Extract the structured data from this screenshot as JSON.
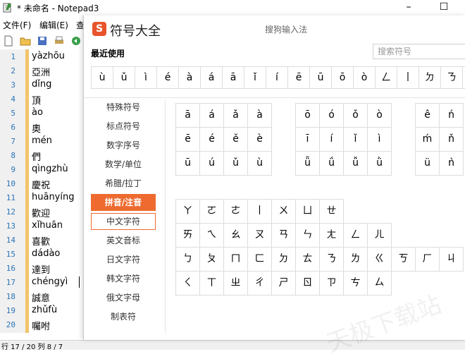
{
  "notepad": {
    "title": "* 未命名 - Notepad3",
    "menu": [
      "文件(F)",
      "编辑(E)",
      "查"
    ],
    "window_controls": [
      "–",
      "☐"
    ],
    "lines": [
      {
        "num": "1",
        "text": "yàzhōu"
      },
      {
        "num": "2",
        "text": "亞洲"
      },
      {
        "num": "3",
        "text": "dǐng"
      },
      {
        "num": "4",
        "text": "頂"
      },
      {
        "num": "5",
        "text": "ào"
      },
      {
        "num": "6",
        "text": "奧"
      },
      {
        "num": "7",
        "text": "mén"
      },
      {
        "num": "8",
        "text": "們"
      },
      {
        "num": "9",
        "text": "qìngzhù"
      },
      {
        "num": "10",
        "text": "慶祝"
      },
      {
        "num": "11",
        "text": "huānyíng"
      },
      {
        "num": "12",
        "text": "歡迎"
      },
      {
        "num": "13",
        "text": "xǐhuān"
      },
      {
        "num": "14",
        "text": "喜歡"
      },
      {
        "num": "15",
        "text": "dádào"
      },
      {
        "num": "16",
        "text": "達到"
      },
      {
        "num": "17",
        "text": "chéngyì"
      },
      {
        "num": "18",
        "text": "誠意"
      },
      {
        "num": "19",
        "text": "zhǔfù"
      },
      {
        "num": "20",
        "text": "囑咐"
      }
    ],
    "status": "行 17 / 20   列 8 / 7"
  },
  "dialog": {
    "logo": "S",
    "title": "符号大全",
    "subtitle": "搜狗输入法",
    "recent_label": "最近使用",
    "search_placeholder": "搜索符号",
    "recent": [
      "ù",
      "ǔ",
      "ì",
      "é",
      "à",
      "á",
      "ā",
      "ǐ",
      "í",
      "ē",
      "ū",
      "ō",
      "ò",
      "ㄥ",
      "丨",
      "ㄉ",
      "ㄋ"
    ],
    "categories": [
      "特殊符号",
      "标点符号",
      "数字序号",
      "数学/单位",
      "希腊/拉丁",
      "拼音/注音",
      "中文字符",
      "英文音标",
      "日文字符",
      "韩文字符",
      "俄文字母",
      "制表符"
    ],
    "active_category": "拼音/注音",
    "hover_category": "中文字符",
    "pinyin_a": [
      [
        "ā",
        "á",
        "ǎ",
        "à"
      ],
      [
        "ē",
        "é",
        "ě",
        "è"
      ],
      [
        "ū",
        "ú",
        "ǔ",
        "ù"
      ]
    ],
    "pinyin_o": [
      [
        "ō",
        "ó",
        "ǒ",
        "ò"
      ],
      [
        "ī",
        "í",
        "ǐ",
        "ì"
      ],
      [
        "ǖ",
        "ǘ",
        "ǚ",
        "ǜ"
      ]
    ],
    "pinyin_e": [
      [
        "ê",
        "ń"
      ],
      [
        "ḿ",
        "ň"
      ],
      [
        "ü",
        "ǹ"
      ]
    ],
    "bopomofo": [
      [
        "ㄚ",
        "ㄛ",
        "ㄜ",
        "丨",
        "ㄨ",
        "ㄩ",
        "ㄝ"
      ],
      [
        "ㄞ",
        "ㄟ",
        "ㄠ",
        "ㄡ",
        "ㄢ",
        "ㄣ",
        "ㄤ",
        "ㄥ",
        "ㄦ"
      ],
      [
        "ㄅ",
        "ㄆ",
        "ㄇ",
        "ㄈ",
        "ㄉ",
        "ㄊ",
        "ㄋ",
        "ㄌ",
        "ㄍ",
        "ㄎ",
        "ㄏ",
        "ㄐ"
      ],
      [
        "ㄑ",
        "ㄒ",
        "ㄓ",
        "ㄔ",
        "ㄕ",
        "ㄖ",
        "ㄗ",
        "ㄘ",
        "ㄙ"
      ]
    ]
  }
}
